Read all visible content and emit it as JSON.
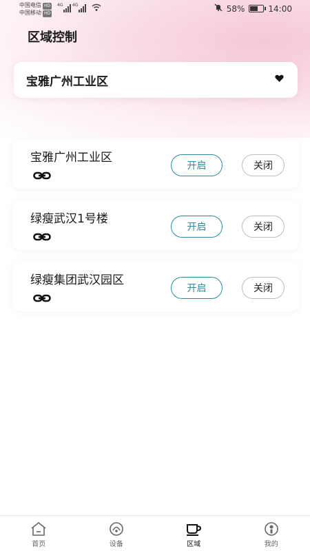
{
  "status_bar": {
    "carrier_1": "中国电信",
    "carrier_2": "中国移动",
    "hd_badge": "HD",
    "net_1": "4G",
    "net_2": "4G",
    "battery": "58%",
    "battery_level": 0.58,
    "time": "14:00"
  },
  "page": {
    "title": "区域控制"
  },
  "selector": {
    "value": "宝雅广州工业区",
    "icon": "heart-icon"
  },
  "zones": [
    {
      "name": "宝雅广州工业区",
      "open_label": "开启",
      "close_label": "关闭"
    },
    {
      "name": "绿瘦武汉1号楼",
      "open_label": "开启",
      "close_label": "关闭"
    },
    {
      "name": "绿瘦集团武汉园区",
      "open_label": "开启",
      "close_label": "关闭"
    }
  ],
  "tabs": [
    {
      "label": "首页",
      "icon": "home-icon"
    },
    {
      "label": "设备",
      "icon": "device-icon"
    },
    {
      "label": "区域",
      "icon": "cup-icon",
      "active": true
    },
    {
      "label": "我的",
      "icon": "user-icon"
    }
  ],
  "colors": {
    "accent": "#2a8c98",
    "background_tint": "#f6c8d6"
  }
}
